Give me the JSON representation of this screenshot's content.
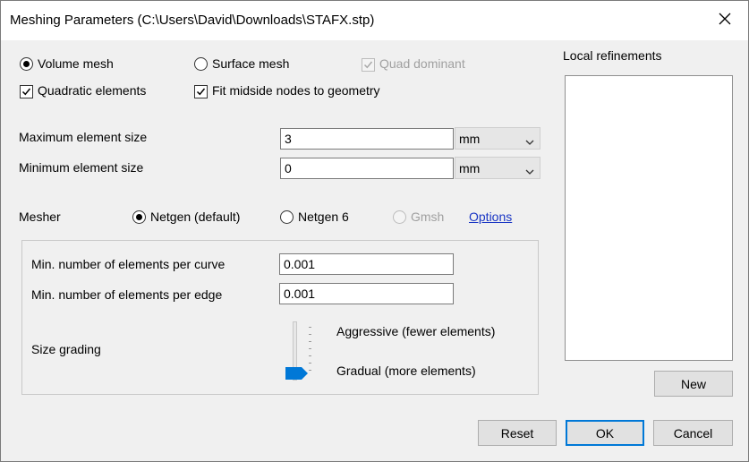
{
  "window": {
    "title": "Meshing Parameters (C:\\Users\\David\\Downloads\\STAFX.stp)"
  },
  "options": {
    "volume_mesh": {
      "label": "Volume mesh",
      "selected": true
    },
    "surface_mesh": {
      "label": "Surface mesh",
      "selected": false
    },
    "quad_dominant": {
      "label": "Quad dominant",
      "checked": true,
      "enabled": false
    },
    "quadratic_elements": {
      "label": "Quadratic elements",
      "checked": true
    },
    "fit_midside": {
      "label": "Fit midside nodes to geometry",
      "checked": true
    }
  },
  "sizes": {
    "max": {
      "label": "Maximum element size",
      "value": "3",
      "unit": "mm"
    },
    "min": {
      "label": "Minimum element size",
      "value": "0",
      "unit": "mm"
    }
  },
  "mesher": {
    "label": "Mesher",
    "netgen_default": {
      "label": "Netgen (default)",
      "selected": true
    },
    "netgen6": {
      "label": "Netgen 6",
      "selected": false
    },
    "gmsh": {
      "label": "Gmsh",
      "enabled": false
    },
    "options_link": "Options"
  },
  "group": {
    "curve": {
      "label": "Min. number of elements per curve",
      "value": "0.001"
    },
    "edge": {
      "label": "Min. number of elements per edge",
      "value": "0.001"
    },
    "grading": {
      "label": "Size grading",
      "aggressive": "Aggressive (fewer elements)",
      "gradual": "Gradual (more elements)",
      "level": 0
    }
  },
  "refinements": {
    "label": "Local refinements",
    "items": [],
    "new_button": "New"
  },
  "footer": {
    "reset": "Reset",
    "ok": "OK",
    "cancel": "Cancel"
  },
  "colors": {
    "accent": "#0078d7",
    "link": "#1a36c4",
    "slider_thumb": "#0078d7"
  }
}
